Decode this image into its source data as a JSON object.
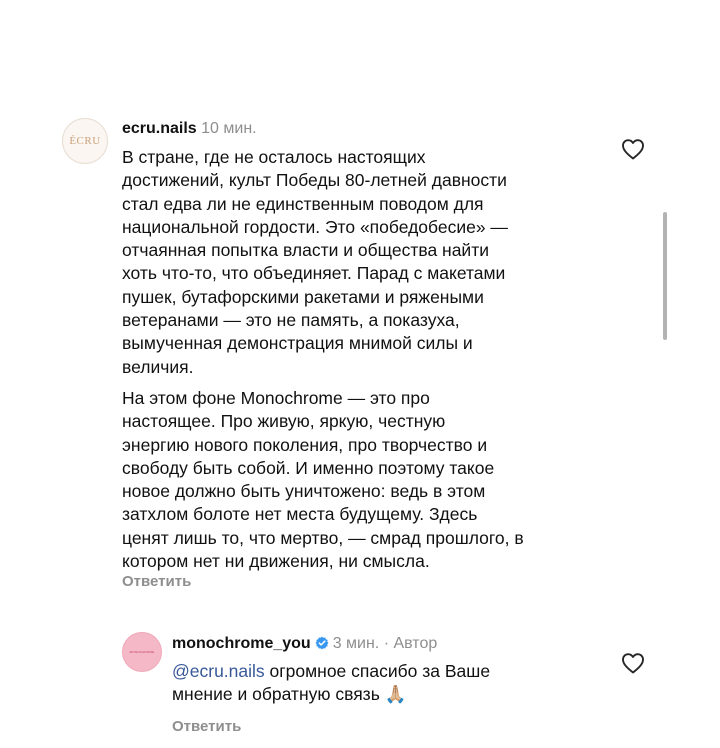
{
  "comments": [
    {
      "avatar_label": "ÉCRU",
      "username": "ecru.nails",
      "time": "10 мин.",
      "paragraphs": [
        [
          "В стране, где не осталось настоящих",
          "достижений, культ Победы 80-летней давности",
          "стал едва ли не единственным поводом для",
          "национальной гордости. Это «победобесие» —",
          "отчаянная попытка власти и общества найти",
          "хоть что-то, что объединяет. Парад с макетами",
          "пушек, бутафорскими ракетами и ряжеными",
          "ветеранами — это не память, а показуха,",
          "вымученная демонстрация мнимой силы и",
          "величия."
        ],
        [
          "На этом фоне Monochrome — это про",
          "настоящее. Про живую, яркую, честную",
          "энергию нового поколения, про творчество и",
          "свободу быть собой. И именно поэтому такое",
          "новое должно быть уничтожено: ведь в этом",
          "затхлом болоте нет места будущему. Здесь",
          "ценят лишь то, что мертво, — смрад прошлого, в",
          "котором нет ни движения, ни смысла."
        ]
      ],
      "reply_label": "Ответить"
    },
    {
      "avatar_label": "MONOCHROME",
      "username": "monochrome_you",
      "time": "3 мин.",
      "author_badge": "· Автор",
      "mention": "@ecru.nails",
      "lines": [
        "огромное спасибо за Ваше",
        "мнение и обратную связь 🙏🏼"
      ],
      "reply_label": "Ответить"
    }
  ],
  "colors": {
    "text": "#111111",
    "meta": "#8e8e8e",
    "mention": "#385898",
    "verified": "#3897f0"
  },
  "icons": {
    "like": "heart-outline-icon",
    "verified": "verified-badge-icon"
  }
}
